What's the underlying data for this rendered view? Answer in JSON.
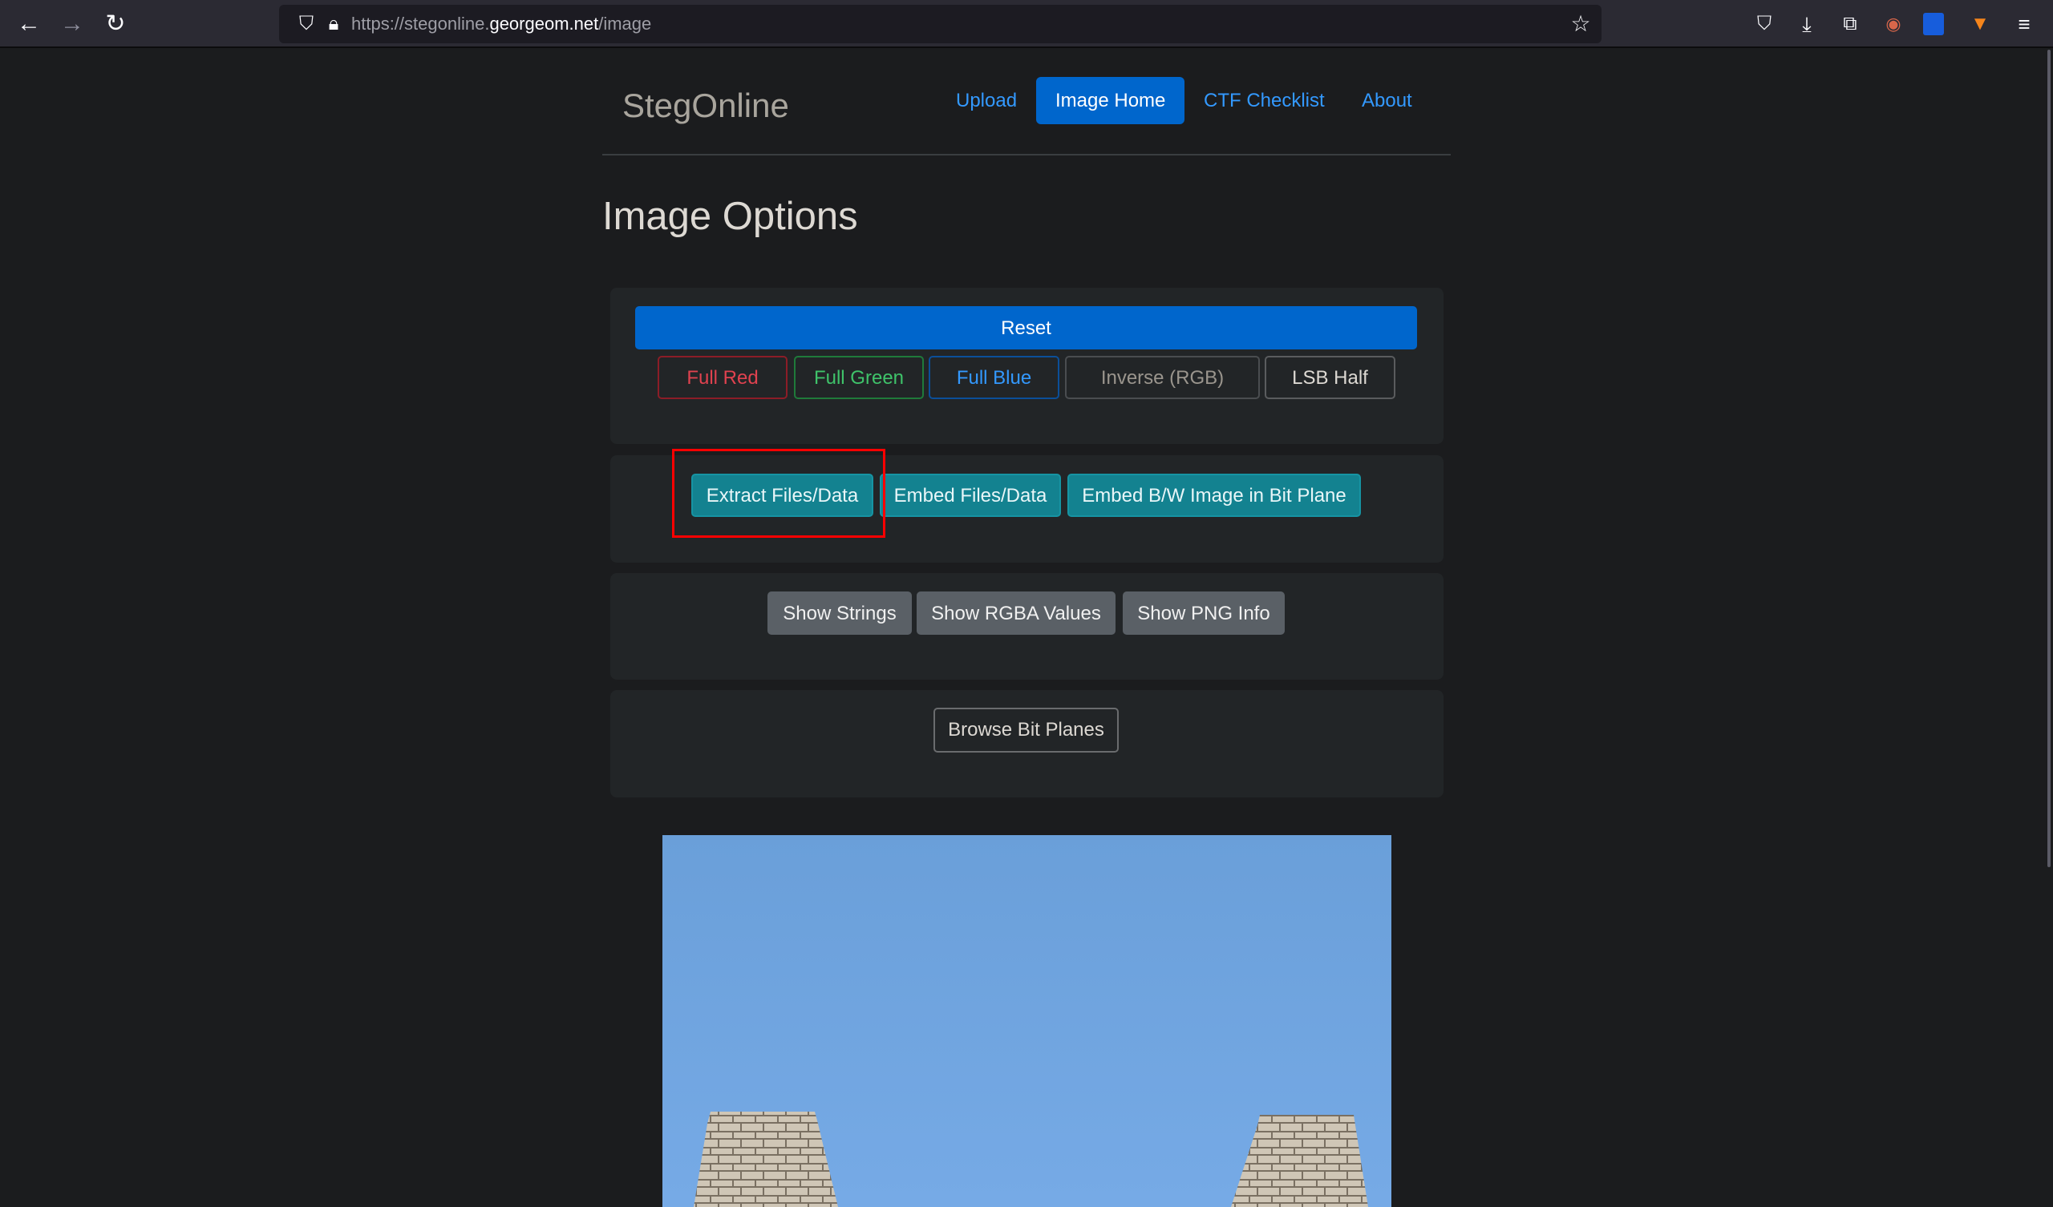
{
  "browser": {
    "url_prefix": "https://stegonline.",
    "url_domain": "georgeom.net",
    "url_path": "/image",
    "icons": [
      "back-icon",
      "forward-icon",
      "reload-icon",
      "shield-icon",
      "lock-icon",
      "star-icon",
      "pocket-icon",
      "download-icon",
      "extensions-icon",
      "spy-extension-icon",
      "bitwarden-icon",
      "metamask-icon",
      "menu-icon"
    ]
  },
  "site": {
    "brand": "StegOnline",
    "nav": [
      {
        "label": "Upload",
        "active": false
      },
      {
        "label": "Image Home",
        "active": true
      },
      {
        "label": "CTF Checklist",
        "active": false
      },
      {
        "label": "About",
        "active": false
      }
    ]
  },
  "page_title": "Image Options",
  "card1": {
    "reset": "Reset",
    "colors": [
      "Full Red",
      "Full Green",
      "Full Blue",
      "Inverse (RGB)",
      "LSB Half"
    ]
  },
  "card2": {
    "buttons": [
      "Extract Files/Data",
      "Embed Files/Data",
      "Embed B/W Image in Bit Plane"
    ],
    "highlighted": "Extract Files/Data"
  },
  "card3": {
    "buttons": [
      "Show Strings",
      "Show RGBA Values",
      "Show PNG Info"
    ]
  },
  "card4": {
    "buttons": [
      "Browse Bit Planes"
    ]
  },
  "colors": {
    "primary": "#0066cc",
    "info": "#138290",
    "red": "#e0424f",
    "green": "#3fc36a",
    "blue": "#3399ff",
    "highlight": "#ff0000"
  }
}
